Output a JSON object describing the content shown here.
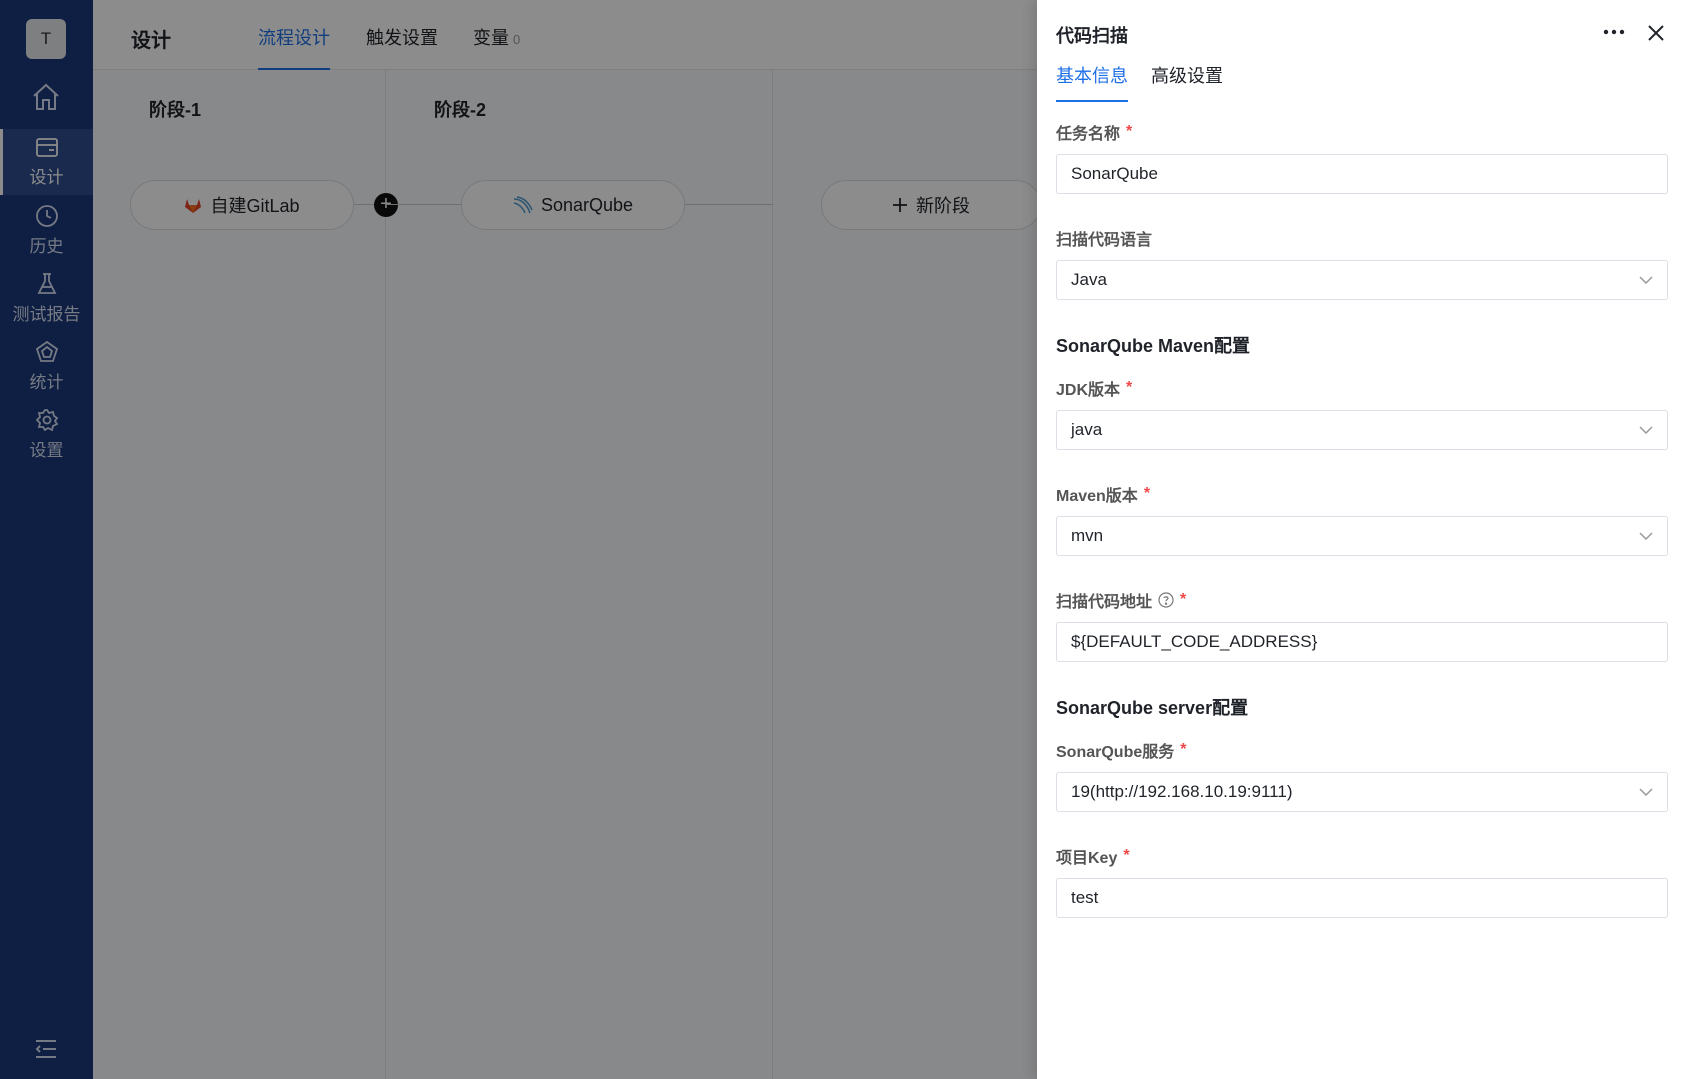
{
  "sidebar": {
    "avatar_letter": "T",
    "items": [
      {
        "label": "设计"
      },
      {
        "label": "历史"
      },
      {
        "label": "测试报告"
      },
      {
        "label": "统计"
      },
      {
        "label": "设置"
      }
    ]
  },
  "header": {
    "title": "设计",
    "tabs": [
      {
        "label": "流程设计"
      },
      {
        "label": "触发设置"
      },
      {
        "label": "变量",
        "count": "0"
      }
    ]
  },
  "pipeline": {
    "stages": [
      {
        "title": "阶段-1",
        "node": "自建GitLab"
      },
      {
        "title": "阶段-2",
        "node": "SonarQube"
      }
    ],
    "new_stage_label": "新阶段"
  },
  "drawer": {
    "title": "代码扫描",
    "tabs": [
      {
        "label": "基本信息"
      },
      {
        "label": "高级设置"
      }
    ],
    "fields": {
      "task_name": {
        "label": "任务名称",
        "value": "SonarQube"
      },
      "scan_language": {
        "label": "扫描代码语言",
        "value": "Java"
      },
      "maven_section": "SonarQube Maven配置",
      "jdk": {
        "label": "JDK版本",
        "value": "java"
      },
      "maven": {
        "label": "Maven版本",
        "value": "mvn"
      },
      "scan_address": {
        "label": "扫描代码地址",
        "value": "${DEFAULT_CODE_ADDRESS}"
      },
      "server_section": "SonarQube server配置",
      "sonar_service": {
        "label": "SonarQube服务",
        "value": "19(http://192.168.10.19:9111)"
      },
      "project_key": {
        "label": "项目Key",
        "value": "test"
      }
    },
    "required_mark": "*"
  },
  "colors": {
    "sidebar_bg": "#1c3a7a",
    "accent": "#1f6fe5",
    "required": "#f04848"
  }
}
